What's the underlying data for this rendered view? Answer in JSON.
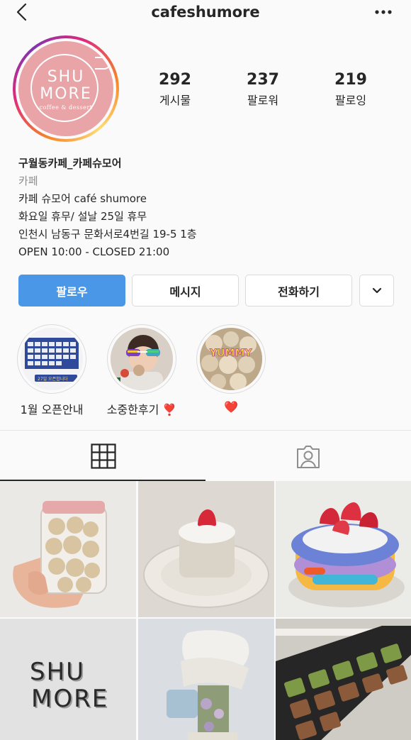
{
  "header": {
    "username": "cafeshumore"
  },
  "profile": {
    "avatar_line1": "SHU",
    "avatar_line2": "MORE",
    "avatar_sub": "coffee & dessert",
    "stats": [
      {
        "value": "292",
        "label": "게시물"
      },
      {
        "value": "237",
        "label": "팔로워"
      },
      {
        "value": "219",
        "label": "팔로잉"
      }
    ]
  },
  "bio": {
    "name": "구월동카페_카페슈모어",
    "category": "카페",
    "lines": [
      "카페 슈모어 café shumore",
      "화요일 휴무/ 설날 25일 휴무",
      "인천시 남동구 문화서로4번길 19-5 1층",
      "OPEN 10:00 - CLOSED 21:00"
    ]
  },
  "actions": {
    "follow": "팔로우",
    "message": "메시지",
    "call": "전화하기"
  },
  "highlights": [
    {
      "label": "1월 오픈안내",
      "cover_text": "27일 오픈합니다"
    },
    {
      "label": "소중한후기 ❣️"
    },
    {
      "label": "❤️",
      "cover_text": "YUMMY"
    }
  ],
  "grid": {
    "tile4_line1": "SHU",
    "tile4_line2": "MORE"
  },
  "colors": {
    "primary_button": "#4a97e8",
    "avatar_bg": "#e8a4a7",
    "text": "#262626",
    "muted": "#8e8e8e"
  }
}
